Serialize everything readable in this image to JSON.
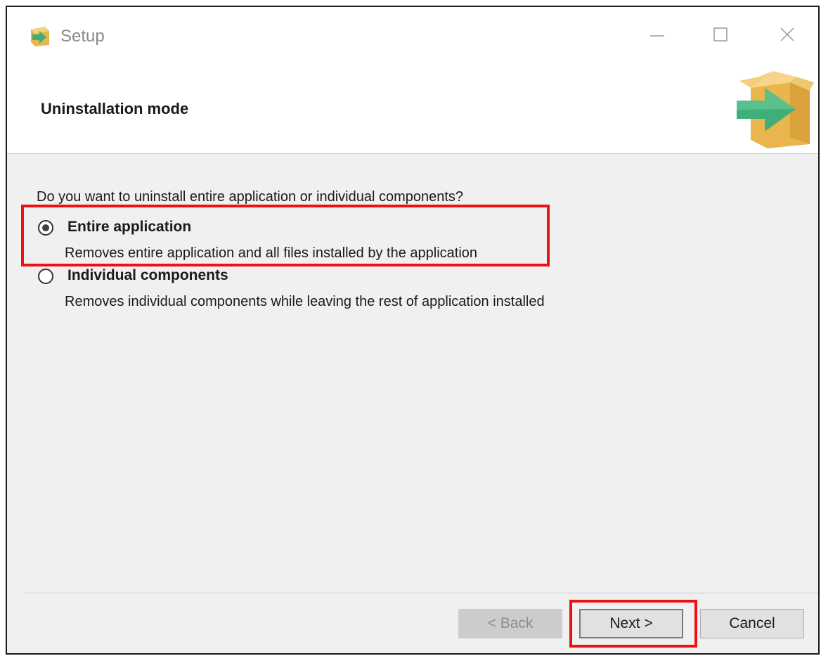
{
  "window": {
    "title": "Setup"
  },
  "header": {
    "title": "Uninstallation mode"
  },
  "content": {
    "question": "Do you want to uninstall entire application or individual components?",
    "options": [
      {
        "label": "Entire application",
        "description": "Removes entire application and all files installed by the application",
        "selected": true
      },
      {
        "label": "Individual components",
        "description": "Removes individual components while leaving the rest of application installed",
        "selected": false
      }
    ]
  },
  "buttons": {
    "back": "< Back",
    "next": "Next >",
    "cancel": "Cancel"
  },
  "icons": {
    "app": "setup-box-icon",
    "minimize": "minimize-icon",
    "maximize": "maximize-icon",
    "close": "close-icon",
    "header_art": "package-arrow-icon"
  },
  "colors": {
    "highlight": "#ee1111",
    "box": "#f2c35f",
    "arrow": "#3fae7a"
  }
}
